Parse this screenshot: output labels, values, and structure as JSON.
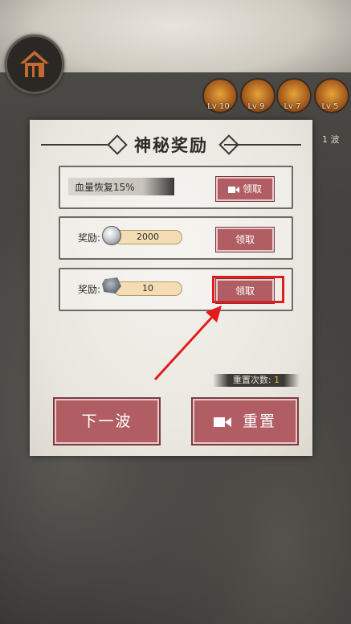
{
  "colors": {
    "accent_red": "#b05e63",
    "highlight": "#e31b1b",
    "count_yellow": "#e6b640"
  },
  "heroes": [
    {
      "level": "Lv 10",
      "icon": "hero-portrait-icon"
    },
    {
      "level": "Lv 9",
      "icon": "hero-portrait-icon"
    },
    {
      "level": "Lv 7",
      "icon": "hero-portrait-icon"
    },
    {
      "level": "Lv 5",
      "icon": "hero-portrait-icon"
    }
  ],
  "wave_label": "1 波",
  "dialog": {
    "title": "神秘奖励",
    "rows": [
      {
        "text": "血量恢复15%",
        "button": "领取",
        "icon": "video-icon"
      },
      {
        "label": "奖励:",
        "amount": "2000",
        "icon": "silver-coin-icon",
        "button": "领取"
      },
      {
        "label": "奖励:",
        "amount": "10",
        "icon": "stone-icon",
        "button": "领取"
      }
    ],
    "reset_count_label": "重置次数:",
    "reset_count_value": "1",
    "next_wave_button": "下一波",
    "reset_button": "重置"
  }
}
